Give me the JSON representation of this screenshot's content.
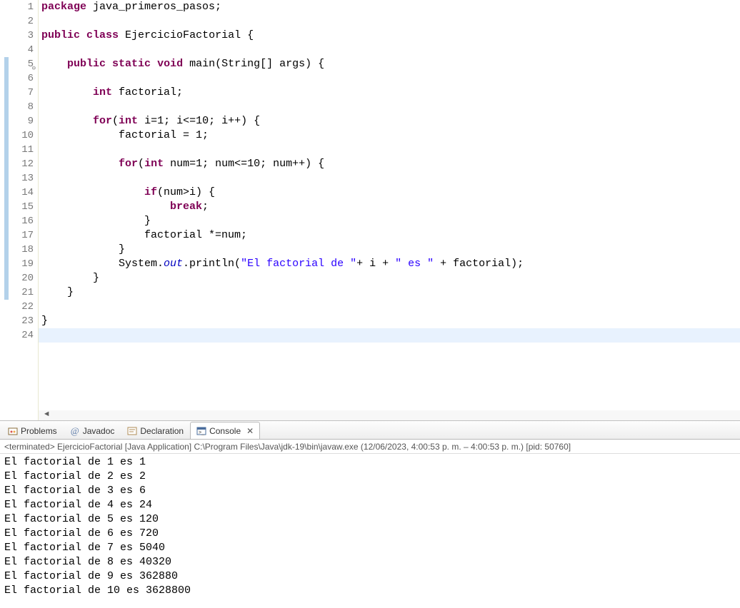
{
  "editor": {
    "lines": [
      {
        "n": 1,
        "segs": [
          {
            "t": "package",
            "c": "kw"
          },
          {
            "t": " java_primeros_pasos;",
            "c": "plain"
          }
        ]
      },
      {
        "n": 2,
        "segs": []
      },
      {
        "n": 3,
        "segs": [
          {
            "t": "public",
            "c": "kw"
          },
          {
            "t": " ",
            "c": "plain"
          },
          {
            "t": "class",
            "c": "kw"
          },
          {
            "t": " EjercicioFactorial {",
            "c": "plain"
          }
        ]
      },
      {
        "n": 4,
        "segs": []
      },
      {
        "n": 5,
        "marker": true,
        "collapse": true,
        "segs": [
          {
            "t": "    ",
            "c": "plain"
          },
          {
            "t": "public",
            "c": "kw"
          },
          {
            "t": " ",
            "c": "plain"
          },
          {
            "t": "static",
            "c": "kw"
          },
          {
            "t": " ",
            "c": "plain"
          },
          {
            "t": "void",
            "c": "kw"
          },
          {
            "t": " main(String[] args) {",
            "c": "plain"
          }
        ]
      },
      {
        "n": 6,
        "marker": true,
        "segs": []
      },
      {
        "n": 7,
        "marker": true,
        "segs": [
          {
            "t": "        ",
            "c": "plain"
          },
          {
            "t": "int",
            "c": "type"
          },
          {
            "t": " factorial;",
            "c": "plain"
          }
        ]
      },
      {
        "n": 8,
        "marker": true,
        "segs": []
      },
      {
        "n": 9,
        "marker": true,
        "segs": [
          {
            "t": "        ",
            "c": "plain"
          },
          {
            "t": "for",
            "c": "kw"
          },
          {
            "t": "(",
            "c": "plain"
          },
          {
            "t": "int",
            "c": "type"
          },
          {
            "t": " i=1; i<=10; i++) {",
            "c": "plain"
          }
        ]
      },
      {
        "n": 10,
        "marker": true,
        "segs": [
          {
            "t": "            factorial = 1;",
            "c": "plain"
          }
        ]
      },
      {
        "n": 11,
        "marker": true,
        "segs": []
      },
      {
        "n": 12,
        "marker": true,
        "segs": [
          {
            "t": "            ",
            "c": "plain"
          },
          {
            "t": "for",
            "c": "kw"
          },
          {
            "t": "(",
            "c": "plain"
          },
          {
            "t": "int",
            "c": "type"
          },
          {
            "t": " num=1; num<=10; num++) {",
            "c": "plain"
          }
        ]
      },
      {
        "n": 13,
        "marker": true,
        "segs": []
      },
      {
        "n": 14,
        "marker": true,
        "segs": [
          {
            "t": "                ",
            "c": "plain"
          },
          {
            "t": "if",
            "c": "kw"
          },
          {
            "t": "(num>i) {",
            "c": "plain"
          }
        ]
      },
      {
        "n": 15,
        "marker": true,
        "segs": [
          {
            "t": "                    ",
            "c": "plain"
          },
          {
            "t": "break",
            "c": "kw"
          },
          {
            "t": ";",
            "c": "plain"
          }
        ]
      },
      {
        "n": 16,
        "marker": true,
        "segs": [
          {
            "t": "                }",
            "c": "plain"
          }
        ]
      },
      {
        "n": 17,
        "marker": true,
        "segs": [
          {
            "t": "                factorial *=num;",
            "c": "plain"
          }
        ]
      },
      {
        "n": 18,
        "marker": true,
        "segs": [
          {
            "t": "            }",
            "c": "plain"
          }
        ]
      },
      {
        "n": 19,
        "marker": true,
        "segs": [
          {
            "t": "            System.",
            "c": "plain"
          },
          {
            "t": "out",
            "c": "field-italic"
          },
          {
            "t": ".println(",
            "c": "plain"
          },
          {
            "t": "\"El factorial de \"",
            "c": "str"
          },
          {
            "t": "+ i + ",
            "c": "plain"
          },
          {
            "t": "\" es \"",
            "c": "str"
          },
          {
            "t": " + factorial);",
            "c": "plain"
          }
        ]
      },
      {
        "n": 20,
        "marker": true,
        "segs": [
          {
            "t": "        }",
            "c": "plain"
          }
        ]
      },
      {
        "n": 21,
        "marker": true,
        "segs": [
          {
            "t": "    }",
            "c": "plain"
          }
        ]
      },
      {
        "n": 22,
        "segs": []
      },
      {
        "n": 23,
        "segs": [
          {
            "t": "}",
            "c": "plain"
          }
        ]
      },
      {
        "n": 24,
        "hl": true,
        "segs": []
      }
    ]
  },
  "tabs": {
    "items": [
      {
        "label": "Problems",
        "active": false,
        "icon": "problems"
      },
      {
        "label": "Javadoc",
        "active": false,
        "icon": "javadoc"
      },
      {
        "label": "Declaration",
        "active": false,
        "icon": "declaration"
      },
      {
        "label": "Console",
        "active": true,
        "icon": "console",
        "closable": true
      }
    ]
  },
  "console": {
    "status": "<terminated> EjercicioFactorial [Java Application] C:\\Program Files\\Java\\jdk-19\\bin\\javaw.exe  (12/06/2023, 4:00:53 p. m. – 4:00:53 p. m.) [pid: 50760]",
    "output": [
      "El factorial de 1 es 1",
      "El factorial de 2 es 2",
      "El factorial de 3 es 6",
      "El factorial de 4 es 24",
      "El factorial de 5 es 120",
      "El factorial de 6 es 720",
      "El factorial de 7 es 5040",
      "El factorial de 8 es 40320",
      "El factorial de 9 es 362880",
      "El factorial de 10 es 3628800"
    ]
  }
}
